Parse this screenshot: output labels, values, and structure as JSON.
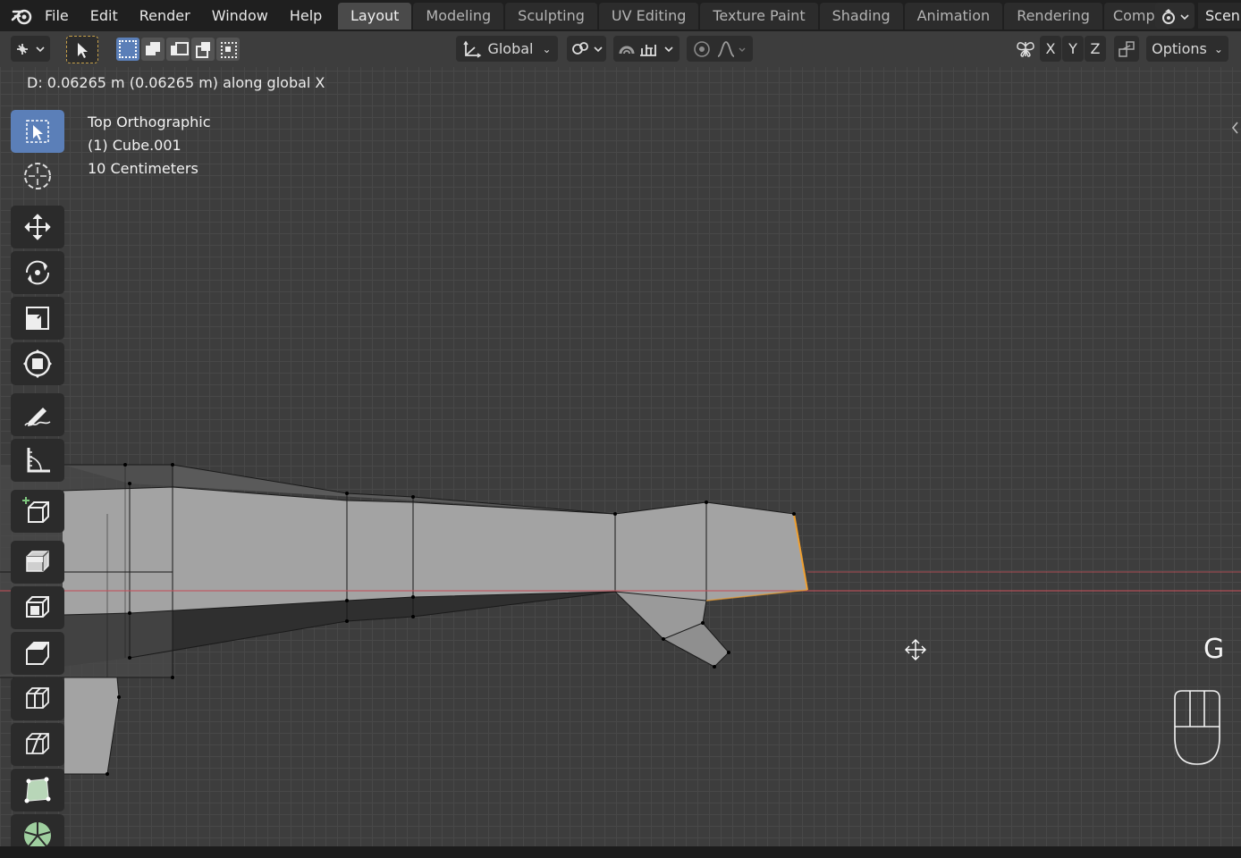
{
  "menu": {
    "items": [
      "File",
      "Edit",
      "Render",
      "Window",
      "Help"
    ]
  },
  "workspaces": {
    "tabs": [
      "Layout",
      "Modeling",
      "Sculpting",
      "UV Editing",
      "Texture Paint",
      "Shading",
      "Animation",
      "Rendering",
      "Compos"
    ],
    "active": "Layout"
  },
  "scene": {
    "name": "Scen"
  },
  "header": {
    "orientation": "Global",
    "axes": [
      "X",
      "Y",
      "Z"
    ],
    "options_label": "Options"
  },
  "viewport": {
    "status": "D: 0.06265 m (0.06265 m) along global X",
    "view_name": "Top Orthographic",
    "object_name": "(1) Cube.001",
    "grid_scale": "10 Centimeters",
    "key_hint": "G"
  },
  "tools": [
    {
      "name": "select-box-tool-icon",
      "active": true
    },
    {
      "name": "cursor-tool-icon",
      "active": false
    },
    {
      "name": "move-tool-icon",
      "active": false
    },
    {
      "name": "rotate-tool-icon",
      "active": false
    },
    {
      "name": "scale-tool-icon",
      "active": false
    },
    {
      "name": "transform-tool-icon",
      "active": false
    },
    {
      "name": "annotate-tool-icon",
      "active": false
    },
    {
      "name": "measure-tool-icon",
      "active": false
    },
    {
      "name": "add-cube-tool-icon",
      "active": false
    },
    {
      "name": "extrude-tool-icon",
      "active": false
    },
    {
      "name": "inset-tool-icon",
      "active": false
    },
    {
      "name": "bevel-tool-icon",
      "active": false
    },
    {
      "name": "loop-cut-tool-icon",
      "active": false
    },
    {
      "name": "knife-tool-icon",
      "active": false
    },
    {
      "name": "poly-build-tool-icon",
      "active": false
    },
    {
      "name": "spin-tool-icon",
      "active": false
    }
  ],
  "colors": {
    "accent": "#5b7fb8",
    "x_axis": "#c4505a",
    "selected_edge": "#f0a030",
    "mesh_face": "#a3a3a3"
  }
}
